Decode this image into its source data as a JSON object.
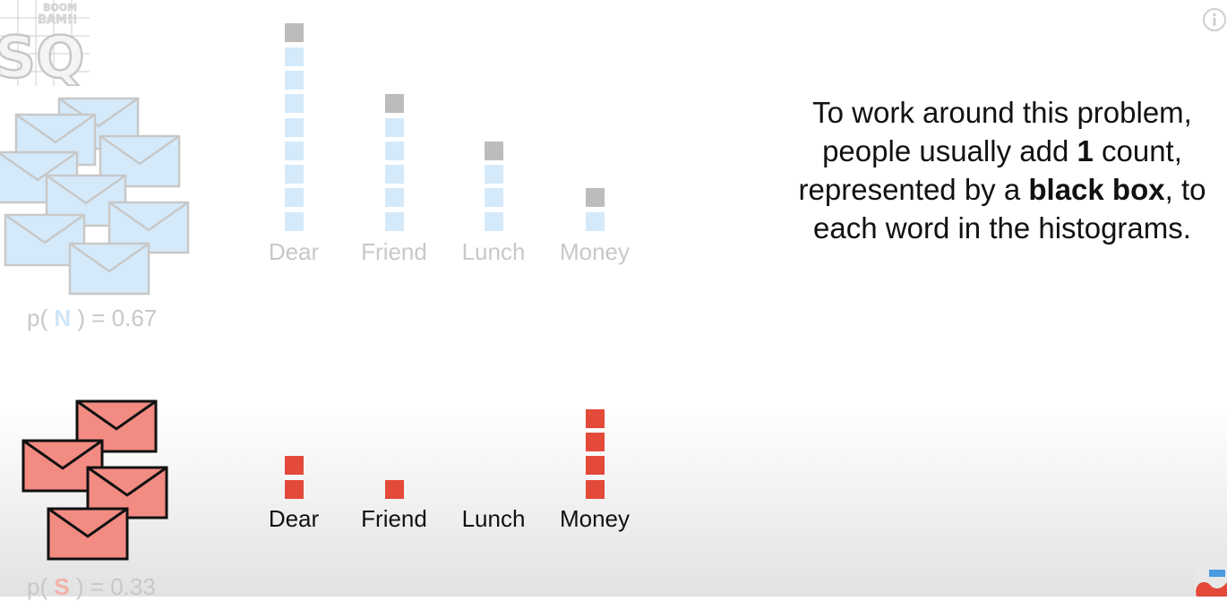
{
  "logo": {
    "text_lines": [
      "BOOM",
      "BAM!!",
      "SQ!"
    ]
  },
  "icons": {
    "info": "info-icon"
  },
  "normal": {
    "class_letter": "N",
    "prob_prefix": "p( ",
    "prob_suffix": " ) = 0.67",
    "bars": [
      {
        "word": "Dear",
        "count": 8
      },
      {
        "word": "Friend",
        "count": 5
      },
      {
        "word": "Lunch",
        "count": 3
      },
      {
        "word": "Money",
        "count": 1
      }
    ],
    "added_count": 1,
    "colors": {
      "box": "#d4eafb",
      "added": "#bcbcbc",
      "envelope": "#d4eafb"
    }
  },
  "spam": {
    "class_letter": "S",
    "prob_prefix": "p( ",
    "prob_suffix": " ) = 0.33",
    "bars": [
      {
        "word": "Dear",
        "count": 2
      },
      {
        "word": "Friend",
        "count": 1
      },
      {
        "word": "Lunch",
        "count": 0
      },
      {
        "word": "Money",
        "count": 4
      }
    ],
    "colors": {
      "box": "#e34a3a",
      "envelope": "#f28b82"
    }
  },
  "caption": {
    "part1": "To work around this problem, people usually add ",
    "bold1": "1",
    "part2": " count, represented by a ",
    "bold2": "black box",
    "part3": ", to each word in the histograms."
  }
}
